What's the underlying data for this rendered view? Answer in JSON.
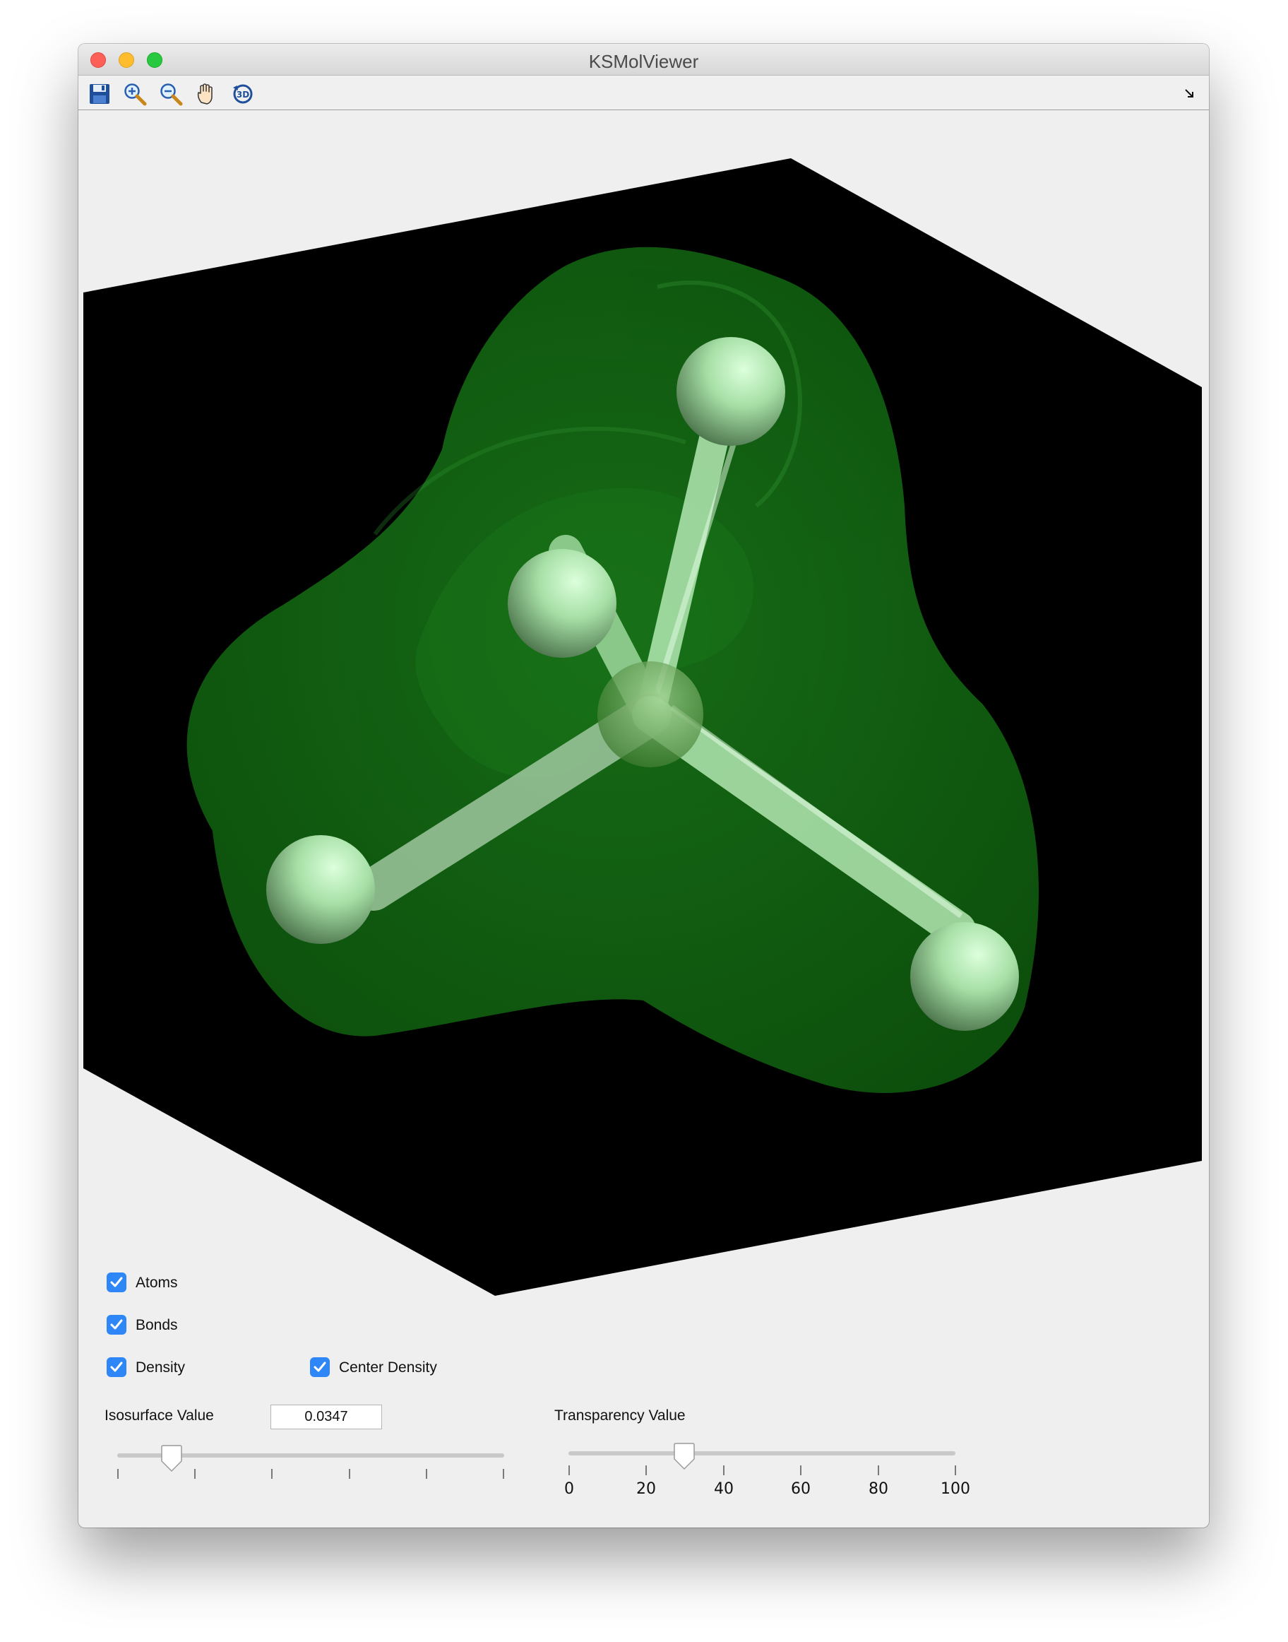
{
  "window": {
    "title": "KSMolViewer"
  },
  "toolbar": {
    "icons": [
      "save-icon",
      "zoom-in-icon",
      "zoom-out-icon",
      "pan-hand-icon",
      "rotate-3d-icon"
    ]
  },
  "controls": {
    "atoms": {
      "label": "Atoms",
      "checked": true
    },
    "bonds": {
      "label": "Bonds",
      "checked": true
    },
    "density": {
      "label": "Density",
      "checked": true
    },
    "center_density": {
      "label": "Center Density",
      "checked": true
    }
  },
  "isosurface": {
    "label": "Isosurface Value",
    "value": "0.0347",
    "slider_fraction": 0.14
  },
  "transparency": {
    "label": "Transparency Value",
    "value": 30,
    "ticks": [
      "0",
      "20",
      "40",
      "60",
      "80",
      "100"
    ]
  },
  "colors": {
    "accent": "#2f86f6",
    "density": "#1f8f1f",
    "atom": "#b8f0b8",
    "background": "#000000"
  }
}
